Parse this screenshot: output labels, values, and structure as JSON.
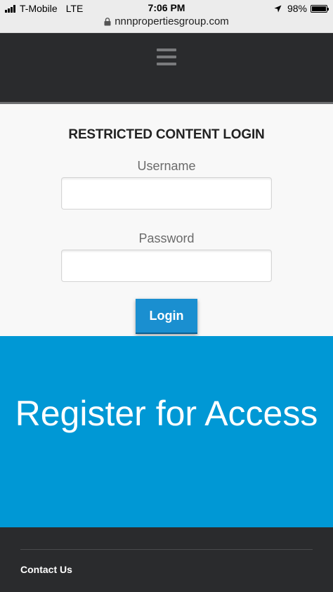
{
  "status_bar": {
    "carrier": "T-Mobile",
    "network": "LTE",
    "time": "7:06 PM",
    "battery_text": "98%",
    "battery_level": 0.98,
    "url": "nnnpropertiesgroup.com"
  },
  "header": {
    "menu_icon": "hamburger-menu-icon"
  },
  "login_form": {
    "title": "RESTRICTED CONTENT LOGIN",
    "username_label": "Username",
    "username_value": "",
    "password_label": "Password",
    "password_value": "",
    "submit_label": "Login"
  },
  "register": {
    "heading": "Register for Access"
  },
  "footer": {
    "contact_link": "Contact Us"
  },
  "colors": {
    "nav_background": "#2a2b2d",
    "accent_blue": "#0098d5",
    "button_blue": "#1a8fd0"
  }
}
